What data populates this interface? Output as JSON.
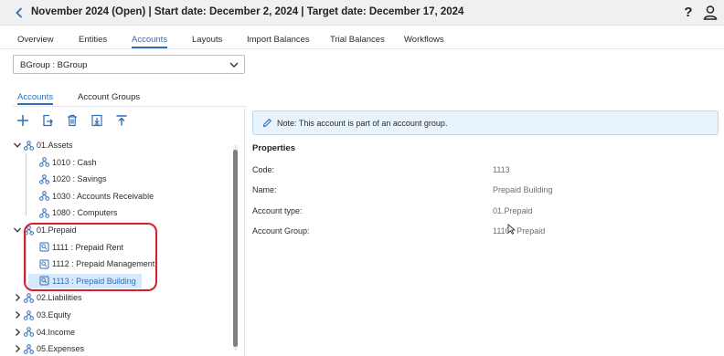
{
  "header": {
    "title": "November 2024 (Open) | Start date: December 2, 2024 | Target date: December 17, 2024",
    "help_label": "?"
  },
  "tabs": [
    {
      "label": "Overview"
    },
    {
      "label": "Entities"
    },
    {
      "label": "Accounts"
    },
    {
      "label": "Layouts"
    },
    {
      "label": "Import Balances"
    },
    {
      "label": "Trial Balances"
    },
    {
      "label": "Workflows"
    }
  ],
  "group_select": {
    "value": "BGroup : BGroup"
  },
  "subtabs": [
    {
      "label": "Accounts"
    },
    {
      "label": "Account Groups"
    }
  ],
  "toolbar": {
    "icons": [
      "add-icon",
      "export-icon",
      "delete-icon",
      "download-icon",
      "upload-icon"
    ]
  },
  "tree": [
    {
      "label": "01.Assets",
      "level": 0,
      "expanded": true,
      "kind": "group"
    },
    {
      "label": "1010 : Cash",
      "level": 1,
      "kind": "account"
    },
    {
      "label": "1020 : Savings",
      "level": 1,
      "kind": "account"
    },
    {
      "label": "1030 : Accounts Receivable",
      "level": 1,
      "kind": "account"
    },
    {
      "label": "1080 : Computers",
      "level": 1,
      "kind": "account"
    },
    {
      "label": "01.Prepaid",
      "level": 0,
      "expanded": true,
      "kind": "group"
    },
    {
      "label": "1111 : Prepaid Rent",
      "level": 1,
      "kind": "grouped-account"
    },
    {
      "label": "1112 : Prepaid Management",
      "level": 1,
      "kind": "grouped-account"
    },
    {
      "label": "1113 : Prepaid Building",
      "level": 1,
      "kind": "grouped-account",
      "selected": true
    },
    {
      "label": "02.Liabilities",
      "level": 0,
      "expanded": false,
      "kind": "group"
    },
    {
      "label": "03.Equity",
      "level": 0,
      "expanded": false,
      "kind": "group"
    },
    {
      "label": "04.Income",
      "level": 0,
      "expanded": false,
      "kind": "group"
    },
    {
      "label": "05.Expenses",
      "level": 0,
      "expanded": false,
      "kind": "group"
    }
  ],
  "note": {
    "text": "Note: This account is part of an account group."
  },
  "properties": {
    "title": "Properties",
    "rows": [
      {
        "label": "Code:",
        "value": "1113"
      },
      {
        "label": "Name:",
        "value": "Prepaid Building"
      },
      {
        "label": "Account type:",
        "value": "01.Prepaid"
      },
      {
        "label": "Account Group:",
        "value": "1110 : Prepaid"
      }
    ]
  },
  "colors": {
    "accent": "#2f6fb6",
    "highlight_border": "#d4202c",
    "selected_row": "#d6e8fb",
    "note_bg": "#e8f3fb"
  }
}
